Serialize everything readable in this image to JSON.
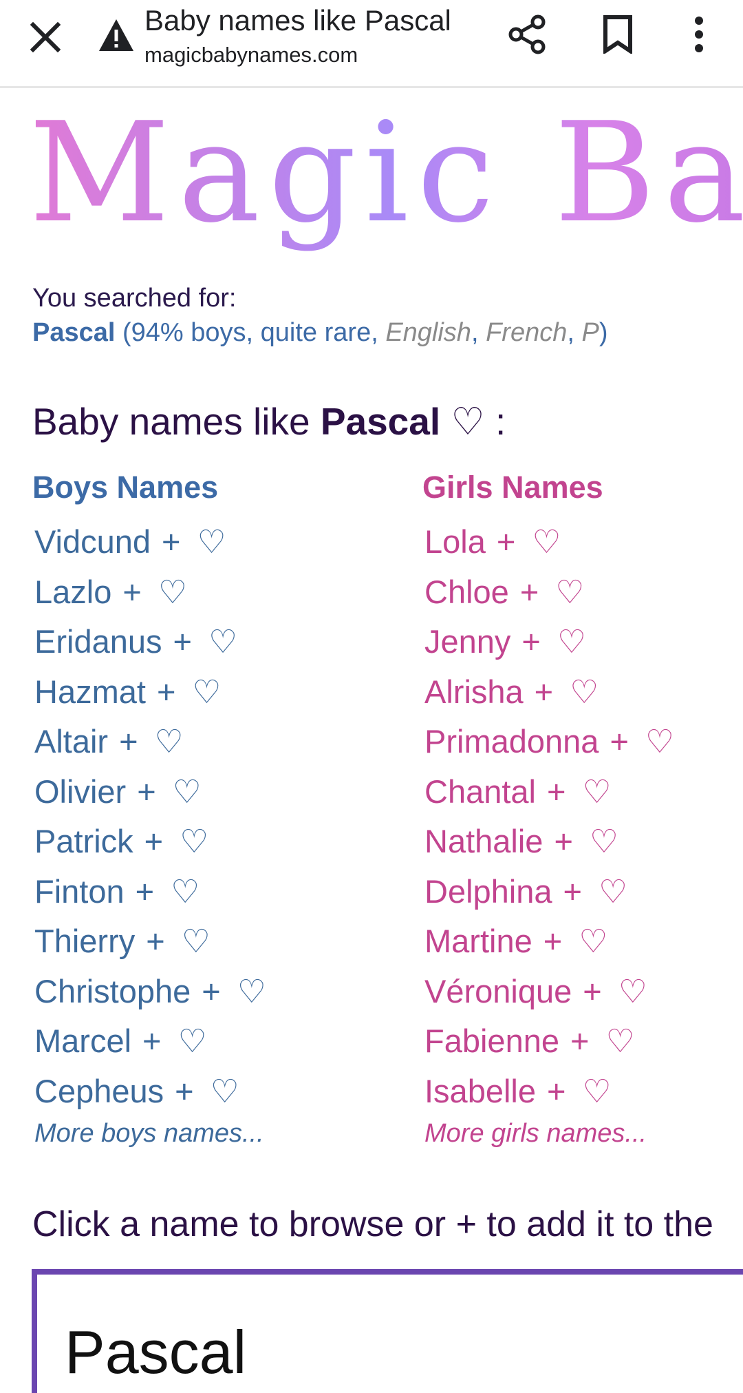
{
  "browser": {
    "title": "Baby names like Pascal",
    "url": "magicbabynames.com"
  },
  "logo": {
    "text": "Magic Ba"
  },
  "search": {
    "label": "You searched for:",
    "name": "Pascal",
    "detail_prefix": " (94% boys, quite rare, ",
    "origin_1": "English",
    "sep_1": ", ",
    "origin_2": "French",
    "sep_2": ", ",
    "origin_3": "P",
    "detail_suffix": ")"
  },
  "heading": {
    "prefix": "Baby names like ",
    "name": "Pascal",
    "heart": "♡",
    "suffix": " :"
  },
  "boys": {
    "title": "Boys Names",
    "names": [
      "Vidcund",
      "Lazlo",
      "Eridanus",
      "Hazmat",
      "Altair",
      "Olivier",
      "Patrick",
      "Finton",
      "Thierry",
      "Christophe",
      "Marcel",
      "Cepheus"
    ],
    "more": "More boys names..."
  },
  "girls": {
    "title": "Girls Names",
    "names": [
      "Lola",
      "Chloe",
      "Jenny",
      "Alrisha",
      "Primadonna",
      "Chantal",
      "Nathalie",
      "Delphina",
      "Martine",
      "Véronique",
      "Fabienne",
      "Isabelle"
    ],
    "more": "More girls names..."
  },
  "symbols": {
    "plus": "+",
    "heart": "♡"
  },
  "instruction": "Click a name to browse or + to add it to the",
  "selected_box": {
    "name": "Pascal"
  },
  "colors": {
    "boys": "#3d6a9b",
    "girls": "#c2448f",
    "heading": "#2b1145",
    "box_border": "#6b46b0"
  },
  "icons": [
    "close-icon",
    "warning-icon",
    "share-icon",
    "bookmark-icon",
    "more-vert-icon"
  ]
}
